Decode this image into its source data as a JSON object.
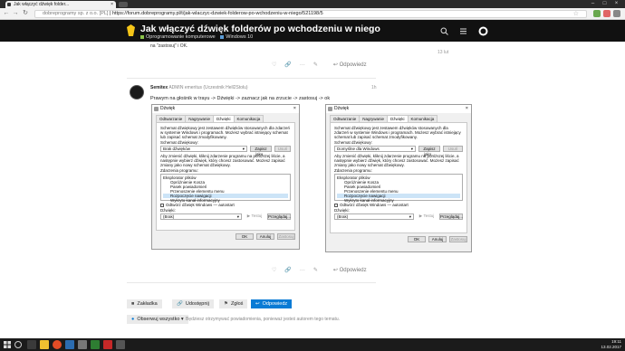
{
  "browser": {
    "tab_title": "Jak włączyć dźwięk folder...",
    "tab_close": "×",
    "win_controls": [
      "–",
      "□",
      "×"
    ],
    "url_secure": "dobreprogramy sp. z o.o. [PL]",
    "url_path": "https://forum.dobreprogramy.pl/t/jak-wlaczyc-dzwiek-folderow-po-wchodzeniu-w-niego/521198/5"
  },
  "site": {
    "title": "Jak włączyć dźwięk folderów po wchodzeniu w niego",
    "categories": [
      "Oprogramowanie komputerowe",
      "Windows 10"
    ],
    "colors": {
      "cat1": "#8bc34a",
      "cat2": "#5b9bd5",
      "accent": "#0a7bd5"
    }
  },
  "prev_post": {
    "tail_text": "na \"zastosuj\" i OK.",
    "reply_label": "Odpowiedz",
    "timeline": "13 lut"
  },
  "post": {
    "author": "Semitex",
    "role": "ADMIN emeritus (Uczestnik Hell2Stolu)",
    "date": "1h",
    "text": "Prawym na głośnik w trayu -> Dźwięki -> zaznacz jak na zrzucie -> zastosuj -> ok",
    "reply_label": "Odpowiedz"
  },
  "dialog": {
    "title": "Dźwięk",
    "tabs": [
      "Odtwarzanie",
      "Nagrywanie",
      "Dźwięki",
      "Komunikacja"
    ],
    "desc": "Schemat dźwiękowy jest zestawem dźwięków stosowanych dla zdarzeń w systemie Windows i programach. Możesz wybrać istniejący schemat lub zapisać schemat zmodyfikowany.",
    "scheme_label": "Schemat dźwiękowy:",
    "scheme_left": "Brak dźwięków",
    "scheme_right": "Domyślne dla Windows",
    "save_as": "Zapisz jako...",
    "delete": "Usuń",
    "change_desc": "Aby zmienić dźwięki, kliknij zdarzenie programu na poniższej liście, a następnie wybierz dźwięk, który chcesz zastosować. Możesz zapisać zmiany jako nowy schemat dźwiękowy.",
    "events_label": "Zdarzenia programu:",
    "events": [
      "Eksplorator plików",
      "Opróżnienie Kosza",
      "Pasek powiadomień",
      "Przenoszenie elementu menu",
      "Rozpoczęcie nawigacji",
      "Wykryto kanał informacyjny"
    ],
    "startup": "Odtwórz dźwięk Windows — autostart",
    "sounds_label": "Dźwięki:",
    "sound_value": "(Brak)",
    "test": "Testuj",
    "browse": "Przeglądaj...",
    "ok": "OK",
    "cancel": "Anuluj",
    "apply": "Zastosuj"
  },
  "post_actions": {
    "bookmark": "Zakładka",
    "share": "Udostępnij",
    "flag": "Zgłoś",
    "reply": "Odpowiedz"
  },
  "watch": {
    "label": "Obserwuj wszystko",
    "note": "Będziesz otrzymywać powiadomienia, ponieważ jesteś autorem tego tematu."
  },
  "taskbar": {
    "time": "19:11",
    "date": "13.02.2017"
  }
}
